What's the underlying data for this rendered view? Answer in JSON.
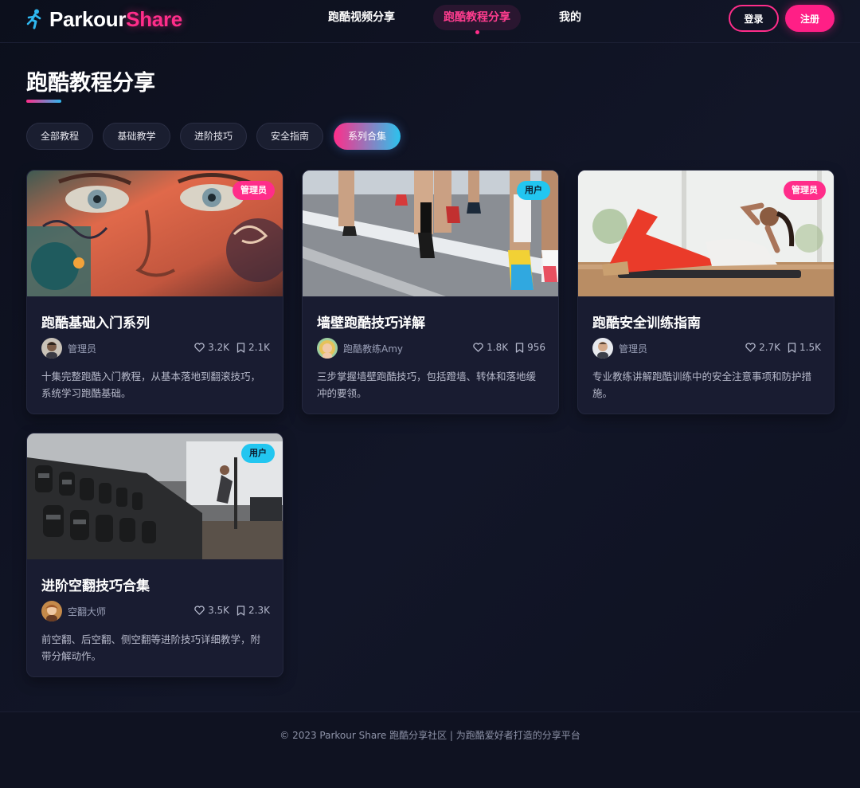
{
  "header": {
    "logo_part1": "Parkour",
    "logo_part2": "Share",
    "nav": [
      "跑酷视频分享",
      "跑酷教程分享",
      "我的"
    ],
    "login": "登录",
    "register": "注册"
  },
  "page": {
    "title": "跑酷教程分享"
  },
  "filters": [
    "全部教程",
    "基础教学",
    "进阶技巧",
    "安全指南",
    "系列合集"
  ],
  "cards": [
    {
      "badge": "管理员",
      "title": "跑酷基础入门系列",
      "author": "管理员",
      "likes": "3.2K",
      "saves": "2.1K",
      "desc": "十集完整跑酷入门教程，从基本落地到翻滚技巧，系统学习跑酷基础。"
    },
    {
      "badge": "用户",
      "title": "墙壁跑酷技巧详解",
      "author": "跑酷教练Amy",
      "likes": "1.8K",
      "saves": "956",
      "desc": "三步掌握墙壁跑酷技巧，包括蹬墙、转体和落地缓冲的要领。"
    },
    {
      "badge": "管理员",
      "title": "跑酷安全训练指南",
      "author": "管理员",
      "likes": "2.7K",
      "saves": "1.5K",
      "desc": "专业教练讲解跑酷训练中的安全注意事项和防护措施。"
    },
    {
      "badge": "用户",
      "title": "进阶空翻技巧合集",
      "author": "空翻大师",
      "likes": "3.5K",
      "saves": "2.3K",
      "desc": "前空翻、后空翻、侧空翻等进阶技巧详细教学，附带分解动作。"
    }
  ],
  "footer": {
    "text": "© 2023 Parkour Share 跑酷分享社区 | 为跑酷爱好者打造的分享平台"
  },
  "icons": {
    "logo": "runner-icon",
    "like": "heart-icon",
    "save": "bookmark-icon"
  },
  "colors": {
    "accent_pink": "#ff2d8a",
    "accent_cyan": "#22c6f0",
    "background": "#0c0f1c",
    "card": "#191c31"
  }
}
